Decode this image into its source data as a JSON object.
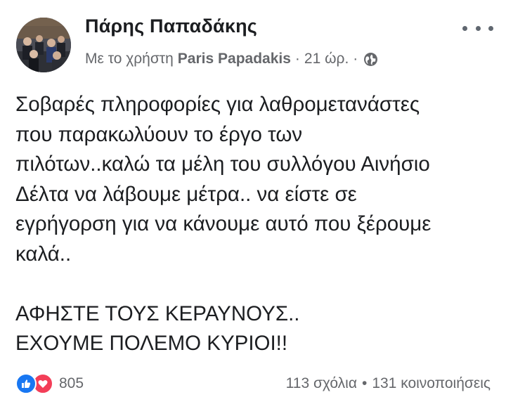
{
  "author": {
    "name": "Πάρης Παπαδάκης"
  },
  "meta": {
    "prefix": "Με το χρήστη",
    "page_name": "Paris Papadakis",
    "separator": "·",
    "time": "21 ώρ.",
    "privacy_icon": "globe-icon"
  },
  "post": {
    "lines": [
      "Σοβαρές πληροφορίες για λαθρομετανάστες",
      "που παρακωλύουν το έργο των",
      "πιλότων..καλώ τα μέλη του συλλόγου Αινήσιο",
      "Δέλτα να λάβουμε μέτρα.. να είστε σε",
      "εγρήγορση για να κάνουμε αυτό που ξέρουμε",
      "καλά..",
      "ΑΦΗΣΤΕ ΤΟΥΣ ΚΕΡΑΥΝΟΥΣ..",
      "ΕΧΟΥΜΕ ΠΟΛΕΜΟ ΚΥΡΙΟΙ!!"
    ]
  },
  "footer": {
    "reaction_count": "805",
    "reaction_icons": [
      "like-icon",
      "love-icon"
    ],
    "comments": "113 σχόλια",
    "dot": "•",
    "shares": "131 κοινοποιήσεις"
  },
  "colors": {
    "like": "#1877f2",
    "love": "#f33e58",
    "meta_text": "#65676b"
  }
}
